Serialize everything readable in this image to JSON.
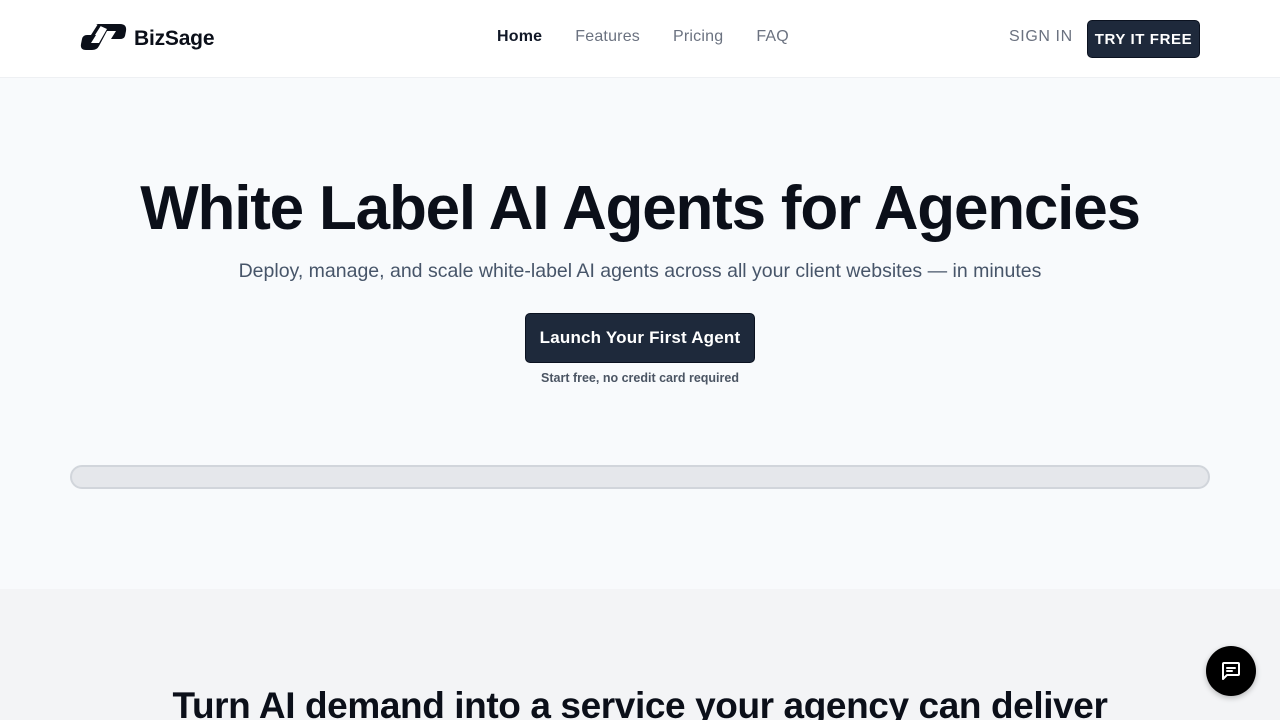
{
  "brand": {
    "name": "BizSage",
    "logo_icon": "bizsage-logo-icon"
  },
  "nav": {
    "items": [
      {
        "label": "Home",
        "active": true
      },
      {
        "label": "Features",
        "active": false
      },
      {
        "label": "Pricing",
        "active": false
      },
      {
        "label": "FAQ",
        "active": false
      }
    ]
  },
  "header_actions": {
    "sign_in_label": "SIGN IN",
    "try_free_label": "TRY IT FREE"
  },
  "hero": {
    "title": "White Label AI Agents for Agencies",
    "subtitle": "Deploy, manage, and scale white-label AI agents across all your client websites — in minutes",
    "cta_label": "Launch Your First Agent",
    "cta_note": "Start free, no credit card required",
    "progress_fraction": 0
  },
  "section2": {
    "title": "Turn AI demand into a service your agency can deliver"
  },
  "chat": {
    "icon": "chat-bubble-icon"
  },
  "colors": {
    "primary_dark": "#1e293b",
    "hero_bg": "#f8fafc",
    "section_bg": "#f3f4f6",
    "text_dark": "#0b0f19",
    "text_muted": "#6b7280"
  }
}
